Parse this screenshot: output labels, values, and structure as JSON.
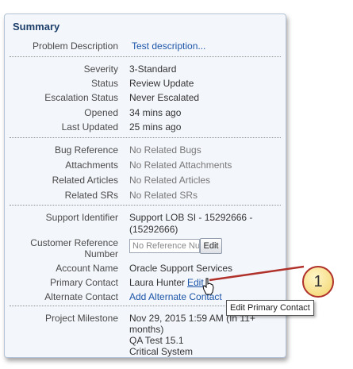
{
  "summary": {
    "title": "Summary",
    "problem_description": {
      "label": "Problem Description",
      "value": "Test description..."
    },
    "severity": {
      "label": "Severity",
      "value": "3-Standard"
    },
    "status": {
      "label": "Status",
      "value": "Review Update"
    },
    "escalation_status": {
      "label": "Escalation Status",
      "value": "Never Escalated"
    },
    "opened": {
      "label": "Opened",
      "value": "34 mins ago"
    },
    "last_updated": {
      "label": "Last Updated",
      "value": "25 mins ago"
    },
    "bug_reference": {
      "label": "Bug Reference",
      "value": "No Related Bugs"
    },
    "attachments": {
      "label": "Attachments",
      "value": "No Related Attachments"
    },
    "related_articles": {
      "label": "Related Articles",
      "value": "No Related Articles"
    },
    "related_srs": {
      "label": "Related SRs",
      "value": "No Related SRs"
    },
    "support_identifier": {
      "label": "Support Identifier",
      "value_line1": "Support LOB SI - 15292666 -",
      "value_line2": "(15292666)"
    },
    "customer_reference": {
      "label_line1": "Customer Reference",
      "label_line2": "Number",
      "placeholder": "No Reference Nu",
      "edit_label": "Edit"
    },
    "account_name": {
      "label": "Account Name",
      "value": "Oracle Support Services"
    },
    "primary_contact": {
      "label": "Primary Contact",
      "value": "Laura Hunter",
      "edit_label": "Edit"
    },
    "alternate_contact": {
      "label": "Alternate Contact",
      "value": "Add Alternate Contact"
    },
    "project_milestone": {
      "label": "Project Milestone",
      "line1": "Nov 29, 2015 1:59 AM (In 11+",
      "line2": "months)",
      "line3": "QA Test 15.1",
      "line4": "Critical System"
    }
  },
  "tooltip": {
    "text": "Edit Primary Contact"
  },
  "callout": {
    "number": "1"
  },
  "colors": {
    "link": "#1c55a8",
    "title": "#1c3e6a",
    "callout_border": "#b0302a",
    "callout_fill": "#f3d46a"
  }
}
